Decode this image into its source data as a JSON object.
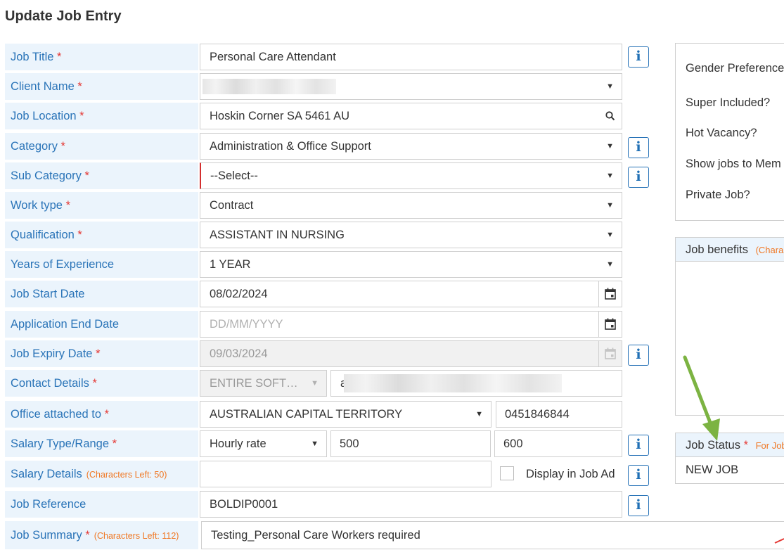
{
  "page_title": "Update Job Entry",
  "required_mark": "*",
  "fields": {
    "job_title": {
      "label": "Job Title",
      "value": "Personal Care Attendant"
    },
    "client_name": {
      "label": "Client Name",
      "value": ""
    },
    "job_location": {
      "label": "Job Location",
      "value": "Hoskin Corner SA 5461 AU"
    },
    "category": {
      "label": "Category",
      "value": "Administration & Office Support"
    },
    "sub_category": {
      "label": "Sub Category",
      "value": "--Select--"
    },
    "work_type": {
      "label": "Work type",
      "value": "Contract"
    },
    "qualification": {
      "label": "Qualification",
      "value": "ASSISTANT IN NURSING"
    },
    "years_experience": {
      "label": "Years of Experience",
      "value": "1 YEAR"
    },
    "job_start_date": {
      "label": "Job Start Date",
      "value": "08/02/2024"
    },
    "application_end_date": {
      "label": "Application End Date",
      "placeholder": "DD/MM/YYYY"
    },
    "job_expiry_date": {
      "label": "Job Expiry Date",
      "value": "09/03/2024"
    },
    "contact_details": {
      "label": "Contact Details",
      "select_value": "ENTIRE SOFT…",
      "text_value": "a"
    },
    "office_attached": {
      "label": "Office attached to",
      "value": "AUSTRALIAN CAPITAL TERRITORY",
      "phone": "0451846844"
    },
    "salary_type": {
      "label": "Salary Type/Range",
      "type_value": "Hourly rate",
      "min": "500",
      "max": "600"
    },
    "salary_details": {
      "label": "Salary Details",
      "hint": "(Characters Left: 50)",
      "value": "",
      "display_label": "Display in Job Ad"
    },
    "job_reference": {
      "label": "Job Reference",
      "value": "BOLDIP0001"
    },
    "job_summary": {
      "label": "Job Summary",
      "hint": "(Characters Left: 112)",
      "value": "Testing_Personal Care Workers required"
    }
  },
  "right_panel": {
    "options": [
      "Gender Preference",
      "Super Included?",
      "Hot Vacancy?",
      "Show jobs to Mem",
      "Private Job?"
    ],
    "benefits_label": "Job benefits",
    "benefits_hint": "(Chara",
    "status_label": "Job Status",
    "status_hint": "For Job",
    "status_value": "NEW JOB"
  },
  "icons": {
    "info": "i",
    "search": "search-icon",
    "calendar": "calendar-icon",
    "caret": "▼"
  },
  "colors": {
    "label_bg": "#ebf4fc",
    "label_text": "#2a74b8",
    "required": "#e53935",
    "hint": "#f07824",
    "info_icon": "#1f6fb5",
    "arrow": "#7cb342"
  }
}
